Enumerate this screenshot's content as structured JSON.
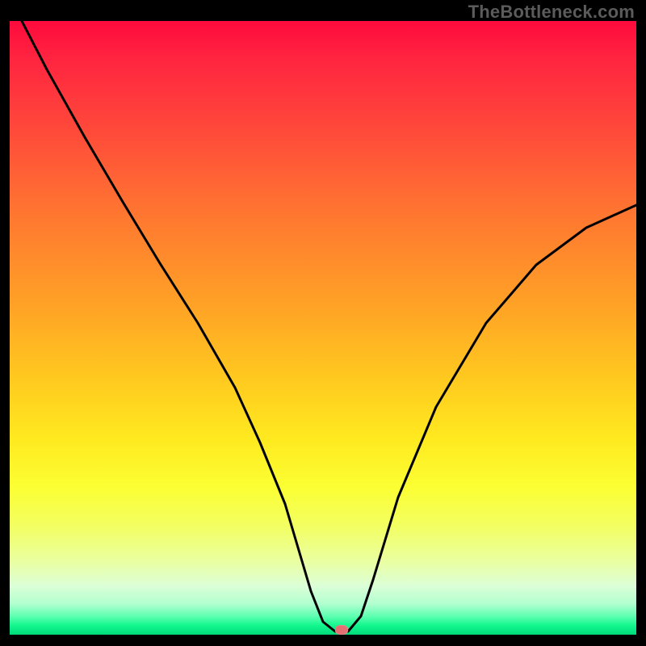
{
  "watermark": "TheBottleneck.com",
  "chart_data": {
    "type": "line",
    "title": "",
    "xlabel": "",
    "ylabel": "",
    "xlim": [
      0,
      100
    ],
    "ylim": [
      0,
      100
    ],
    "series": [
      {
        "name": "curve",
        "x": [
          2,
          6,
          12,
          18,
          24,
          30,
          36,
          40,
          44,
          46,
          48,
          50,
          52,
          54,
          56,
          58,
          62,
          68,
          76,
          84,
          92,
          100
        ],
        "y": [
          100,
          92,
          81,
          71,
          61,
          51,
          40,
          31,
          21,
          14,
          7,
          2,
          0.5,
          0.5,
          3,
          9,
          22,
          37,
          51,
          60,
          66,
          70
        ]
      }
    ],
    "marker": {
      "x": 53,
      "y": 0.5
    },
    "background_gradient": {
      "top_color": "#ff0a3d",
      "mid_color": "#ffe91f",
      "bottom_color": "#00d97a"
    },
    "curve_color": "#000000",
    "marker_color": "#e36f73"
  }
}
